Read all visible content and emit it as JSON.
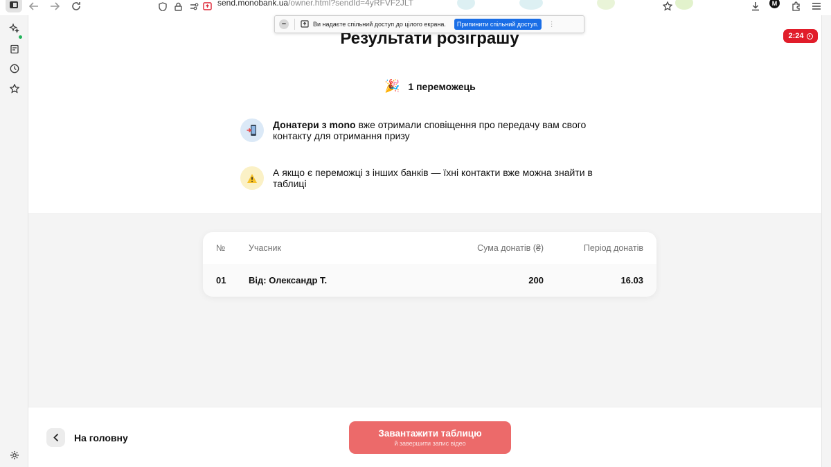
{
  "browser": {
    "url_host": "send.monobank.ua",
    "url_path": "/owner.html?sendId=4yRFVF2JLT",
    "avatar_letter": "M"
  },
  "share_bar": {
    "message": "Ви надаєте спільний доступ до цілого екрана.",
    "stop_label": "Припинити спільний доступ."
  },
  "timer": {
    "value": "2:24"
  },
  "page": {
    "title": "Результати розіграшу",
    "winners_count": "1 переможець",
    "info_1_bold": "Донатери з mono",
    "info_1_text": " вже отримали сповіщення про передачу вам свого контакту для отримання призу",
    "info_2_text": "А якщо є переможці з інших банків — їхні контакти вже можна знайти в таблиці"
  },
  "table": {
    "headers": {
      "num": "№",
      "participant": "Учасник",
      "sum": "Сума донатів (₴)",
      "period": "Період донатів"
    },
    "rows": [
      {
        "num": "01",
        "participant": "Від: Олександр Т.",
        "sum": "200",
        "period": "16.03"
      }
    ]
  },
  "footer": {
    "back_label": "На головну",
    "download_label": "Завантажити таблицю",
    "download_sub": "й завершити запис відео"
  }
}
